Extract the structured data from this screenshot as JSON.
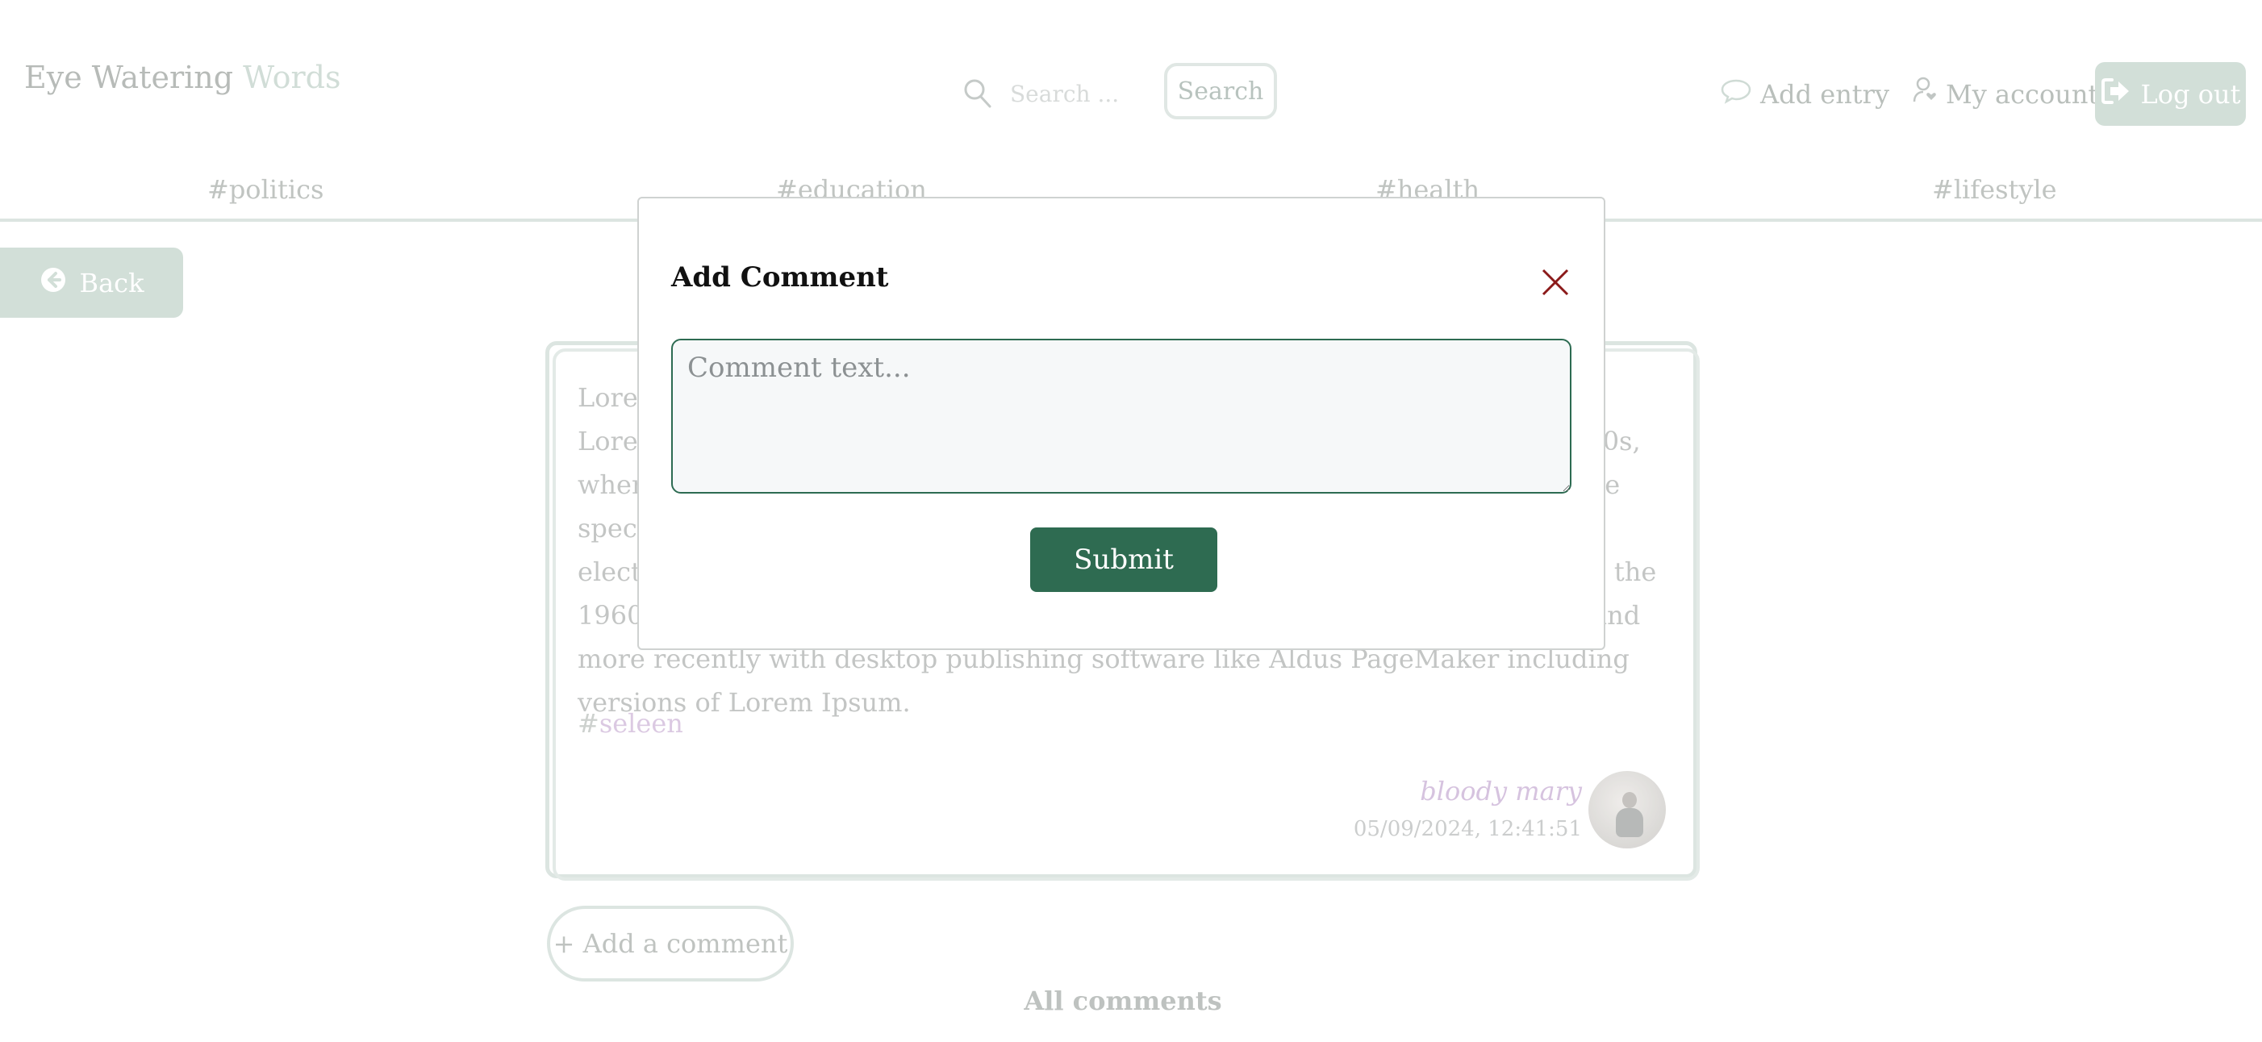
{
  "header": {
    "logo_part1": "Eye Watering ",
    "logo_part2": "Words",
    "search_placeholder": "Search ...",
    "search_button": "Search",
    "add_entry": "Add entry",
    "my_account": "My account",
    "log_out": "Log out"
  },
  "tabs": [
    {
      "label": "#politics"
    },
    {
      "label": "#education"
    },
    {
      "label": "#health"
    },
    {
      "label": "#lifestyle"
    }
  ],
  "back_label": "Back",
  "post": {
    "body": "Lorem Ipsum is simply dummy text of the printing and typesetting industry. Lorem Ipsum has been the industry's standard dummy text ever since the 1500s, when an unknown printer took a galley of type and scrambled it to make a type specimen book. It has survived not only five centuries, but also the leap into electronic typesetting, remaining essentially unchanged. It was popularised in the 1960s with the release of Letraset sheets containing Lorem Ipsum passages, and more recently with desktop publishing software like Aldus PageMaker including versions of Lorem Ipsum.",
    "tag_hash": "#",
    "tag": "seleen",
    "author": "bloody mary",
    "date": "05/09/2024, 12:41:51"
  },
  "add_comment_label": "+ Add a comment",
  "all_comments_label": "All comments",
  "modal": {
    "title": "Add Comment",
    "textarea_placeholder": "Comment text...",
    "submit_label": "Submit"
  },
  "colors": {
    "primary": "#2e6b51",
    "accent_muted": "#c9d8d0",
    "close": "#8b1a1a",
    "tag": "#d4bedc"
  }
}
